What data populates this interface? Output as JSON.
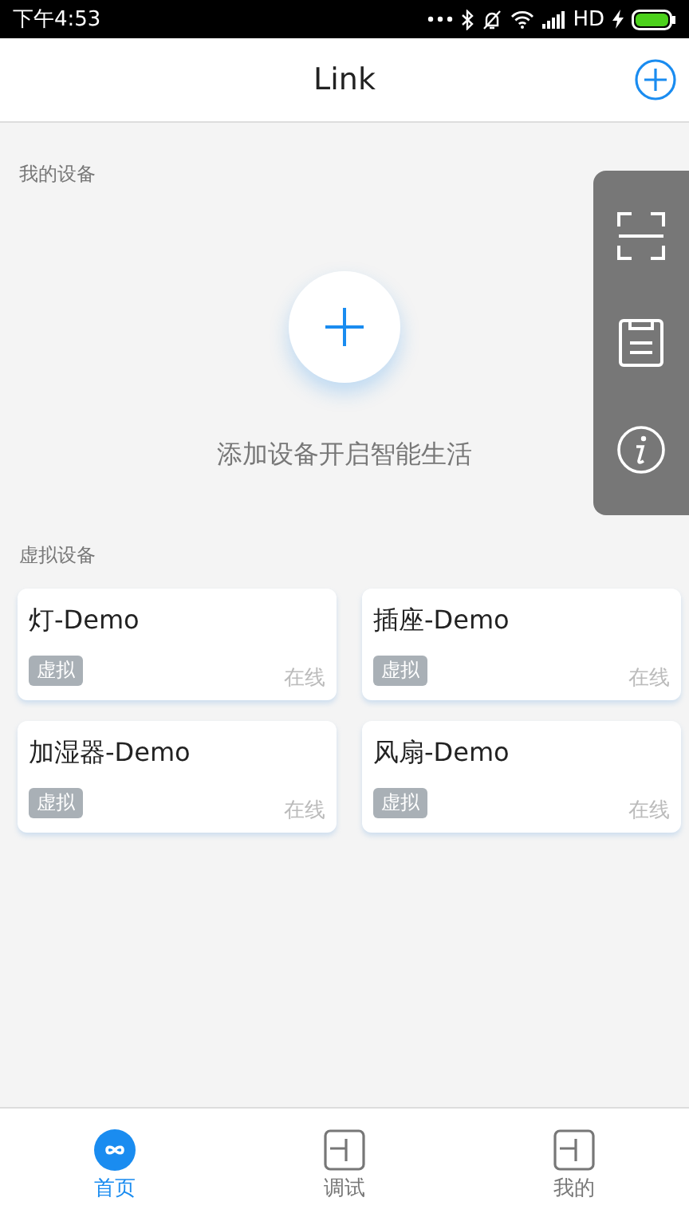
{
  "status_bar": {
    "time": "下午4:53",
    "network": "HD"
  },
  "header": {
    "title": "Link"
  },
  "my_devices": {
    "heading": "我的设备",
    "add_hint": "添加设备开启智能生活"
  },
  "virtual_devices": {
    "heading": "虚拟设备",
    "items": [
      {
        "name": "灯-Demo",
        "tag": "虚拟",
        "status": "在线"
      },
      {
        "name": "插座-Demo",
        "tag": "虚拟",
        "status": "在线"
      },
      {
        "name": "加湿器-Demo",
        "tag": "虚拟",
        "status": "在线"
      },
      {
        "name": "风扇-Demo",
        "tag": "虚拟",
        "status": "在线"
      }
    ]
  },
  "tabs": [
    {
      "label": "首页",
      "kind": "link",
      "selected": true
    },
    {
      "label": "调试",
      "kind": "box",
      "selected": false
    },
    {
      "label": "我的",
      "kind": "box",
      "selected": false
    }
  ]
}
